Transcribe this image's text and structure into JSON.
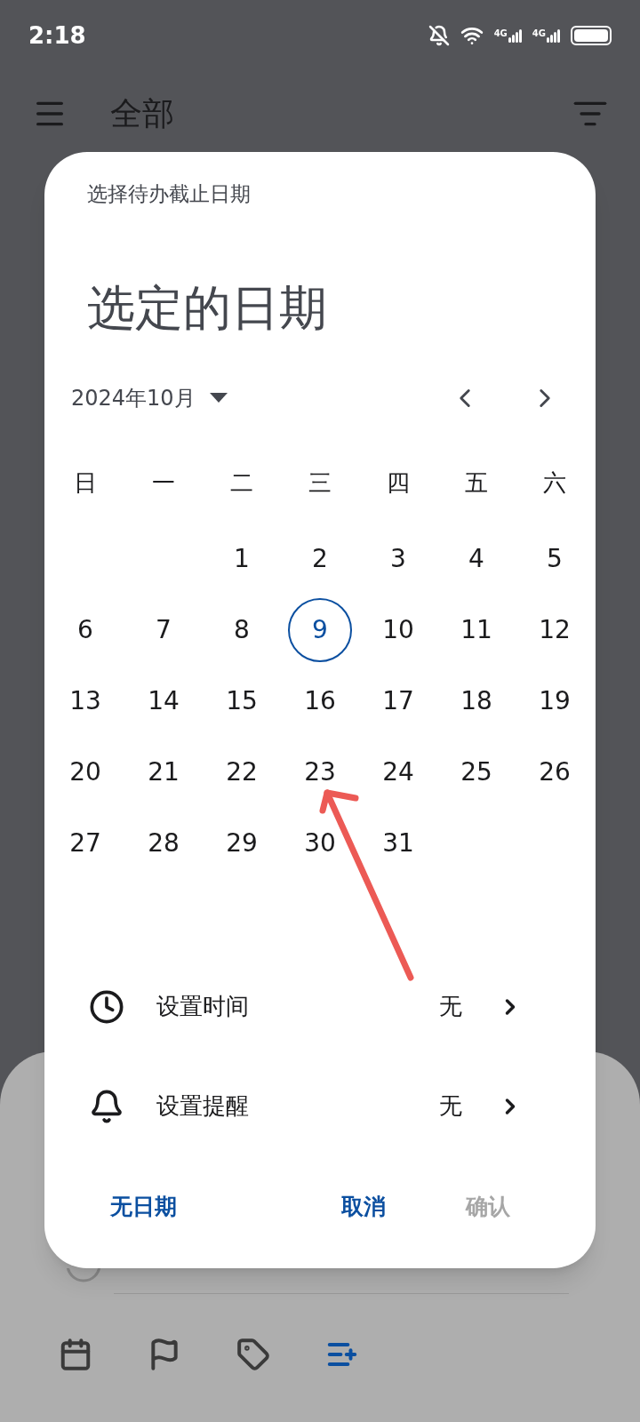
{
  "status_bar": {
    "time": "2:18",
    "network_labels": [
      "4G",
      "4G"
    ]
  },
  "app_bar": {
    "title": "全部"
  },
  "dialog": {
    "subtitle": "选择待办截止日期",
    "headline": "选定的日期",
    "month": "2024年10月",
    "weekdays": [
      "日",
      "一",
      "二",
      "三",
      "四",
      "五",
      "六"
    ],
    "weeks": [
      {
        "kind": "leading",
        "days": [
          {
            "day": "1",
            "today": false
          },
          {
            "day": "2",
            "today": false
          },
          {
            "day": "3",
            "today": false
          },
          {
            "day": "4",
            "today": false
          },
          {
            "day": "5",
            "today": false
          }
        ]
      },
      {
        "kind": "full",
        "days": [
          {
            "day": "6",
            "today": false
          },
          {
            "day": "7",
            "today": false
          },
          {
            "day": "8",
            "today": false
          },
          {
            "day": "9",
            "today": true
          },
          {
            "day": "10",
            "today": false
          },
          {
            "day": "11",
            "today": false
          },
          {
            "day": "12",
            "today": false
          }
        ]
      },
      {
        "kind": "full",
        "days": [
          {
            "day": "13",
            "today": false
          },
          {
            "day": "14",
            "today": false
          },
          {
            "day": "15",
            "today": false
          },
          {
            "day": "16",
            "today": false
          },
          {
            "day": "17",
            "today": false
          },
          {
            "day": "18",
            "today": false
          },
          {
            "day": "19",
            "today": false
          }
        ]
      },
      {
        "kind": "full",
        "days": [
          {
            "day": "20",
            "today": false
          },
          {
            "day": "21",
            "today": false
          },
          {
            "day": "22",
            "today": false
          },
          {
            "day": "23",
            "today": false
          },
          {
            "day": "24",
            "today": false
          },
          {
            "day": "25",
            "today": false
          },
          {
            "day": "26",
            "today": false
          }
        ]
      },
      {
        "kind": "trailing",
        "days": [
          {
            "day": "27",
            "today": false
          },
          {
            "day": "28",
            "today": false
          },
          {
            "day": "29",
            "today": false
          },
          {
            "day": "30",
            "today": false
          },
          {
            "day": "31",
            "today": false
          }
        ]
      }
    ],
    "settings": [
      {
        "kind": "time",
        "label": "设置时间",
        "value": "无"
      },
      {
        "kind": "reminder",
        "label": "设置提醒",
        "value": "无"
      }
    ],
    "actions": [
      {
        "label": "无日期",
        "disabled": false
      },
      {
        "label": "取消",
        "disabled": false
      },
      {
        "label": "确认",
        "disabled": true
      }
    ]
  },
  "task": {
    "checked": false
  },
  "toolbar": [
    {
      "kind": "calendar",
      "active": false
    },
    {
      "kind": "flag",
      "active": false
    },
    {
      "kind": "tag",
      "active": false
    },
    {
      "kind": "add-list",
      "active": true
    }
  ]
}
